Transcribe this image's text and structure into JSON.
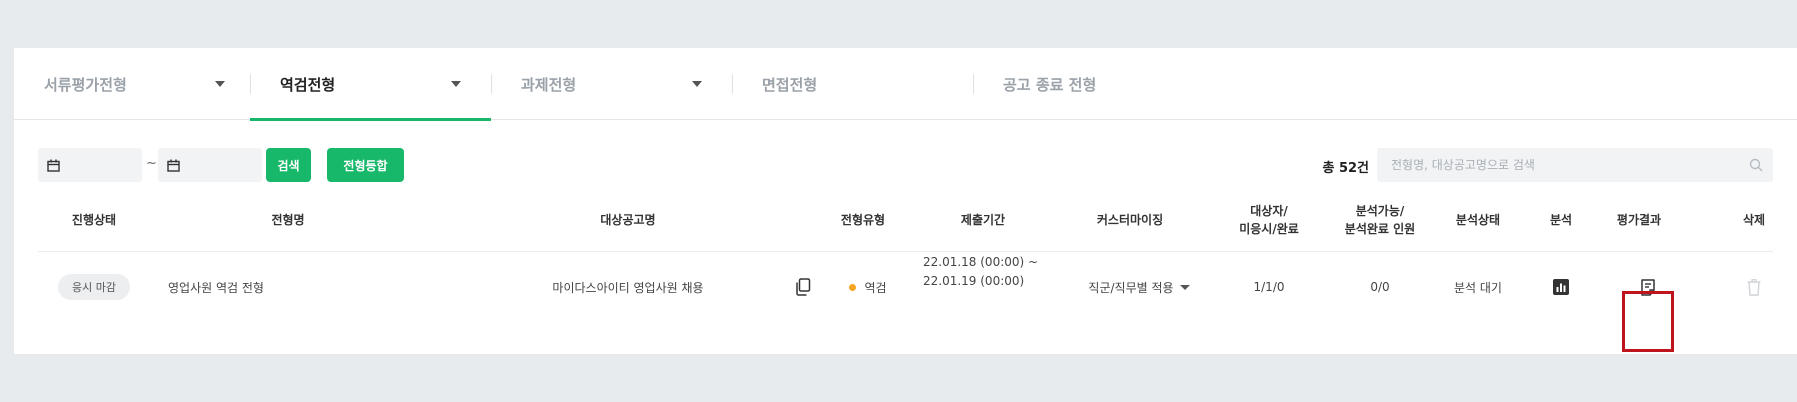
{
  "tabs": [
    {
      "label": "서류평가전형",
      "active": false,
      "has_dropdown": true
    },
    {
      "label": "역검전형",
      "active": true,
      "has_dropdown": true
    },
    {
      "label": "과제전형",
      "active": false,
      "has_dropdown": true
    },
    {
      "label": "면접전형",
      "active": false,
      "has_dropdown": false
    },
    {
      "label": "공고 종료 전형",
      "active": false,
      "has_dropdown": false
    }
  ],
  "filters": {
    "date_separator": "~",
    "search_button": "검색",
    "register_button": "전형등합",
    "total_label": "총 52건",
    "search_placeholder": "전형명, 대상공고명으로 검색",
    "icons": {
      "date": "calendar-icon",
      "search": "search-icon"
    }
  },
  "table": {
    "headers": {
      "status": "진행상태",
      "name": "전형명",
      "posting": "대상공고명",
      "type": "전형유형",
      "period": "제출기간",
      "custom": "커스터마이징",
      "counts_line1": "대상자/",
      "counts_line2": "미응시/완료",
      "analyzable_line1": "분석가능/",
      "analyzable_line2": "분석완료 인원",
      "analysis_status": "분석상태",
      "analysis": "분석",
      "result": "평가결과",
      "delete": "삭제"
    },
    "rows": [
      {
        "status": "응시 마감",
        "name": "영업사원 역검 전형",
        "posting": "마이다스아이티 영업사원 채용",
        "type": "역검",
        "period_start": "22.01.18 (00:00) ~",
        "period_end": "22.01.19 (00:00)",
        "custom": "직군/직무별 적용",
        "counts": "1/1/0",
        "analyzable": "0/0",
        "analysis_status": "분석 대기",
        "icons": {
          "copy": "copy-icon",
          "analysis": "bar-chart-icon",
          "result": "document-icon",
          "delete": "trash-icon"
        }
      }
    ]
  },
  "colors": {
    "accent": "#18b86a",
    "type_dot": "#f5a623",
    "highlight": "#c0141c"
  }
}
